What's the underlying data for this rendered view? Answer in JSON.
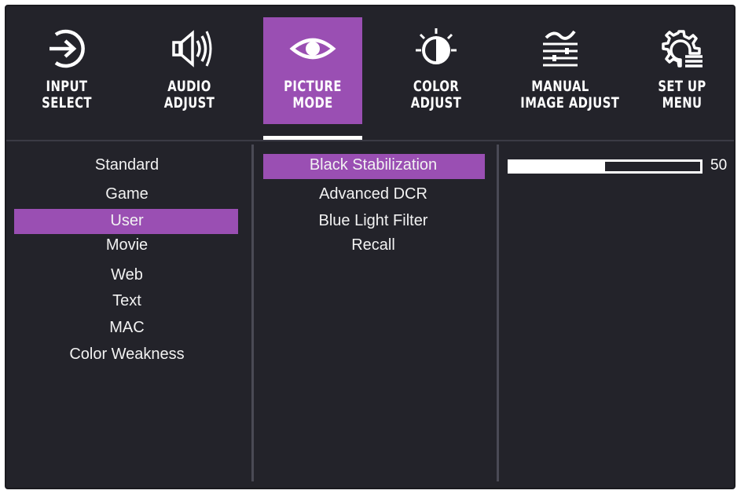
{
  "tabs": [
    {
      "name": "input-select",
      "line1": "INPUT",
      "line2": "SELECT",
      "icon": "input-icon"
    },
    {
      "name": "audio-adjust",
      "line1": "AUDIO",
      "line2": "ADJUST",
      "icon": "speaker-icon"
    },
    {
      "name": "picture-mode",
      "line1": "PICTURE",
      "line2": "MODE",
      "icon": "eye-icon"
    },
    {
      "name": "color-adjust",
      "line1": "COLOR",
      "line2": "ADJUST",
      "icon": "color-icon"
    },
    {
      "name": "manual-image-adjust",
      "line1": "MANUAL",
      "line2": "IMAGE ADJUST",
      "icon": "sliders-icon"
    },
    {
      "name": "setup-menu",
      "line1": "SET UP",
      "line2": "MENU",
      "icon": "gear-menu-icon"
    }
  ],
  "active_tab": "PICTURE MODE",
  "modes": {
    "items": [
      "Standard",
      "Game",
      "User",
      "Movie",
      "Web",
      "Text",
      "MAC",
      "Color Weakness"
    ],
    "selected": "User"
  },
  "options": {
    "items": [
      "Black Stabilization",
      "Advanced DCR",
      "Blue Light Filter",
      "Recall"
    ],
    "selected": "Black Stabilization"
  },
  "slider": {
    "value": "50",
    "level_percent": 50
  },
  "colors": {
    "accent": "#9a4fb3",
    "background": "#23232a",
    "text": "#ffffff"
  }
}
